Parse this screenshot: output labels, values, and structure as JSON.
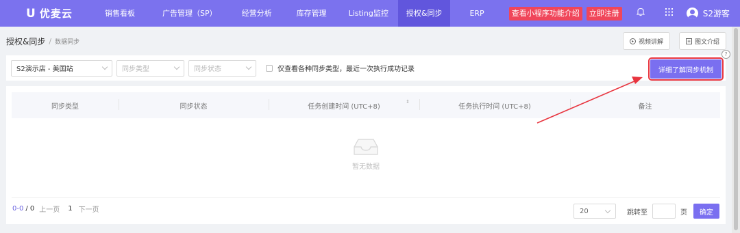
{
  "app": {
    "logo_mark": "U",
    "logo_text": "优麦云"
  },
  "nav": {
    "items": [
      "销售看板",
      "广告管理（SP）",
      "经营分析",
      "库存管理",
      "Listing监控",
      "授权&同步",
      "ERP"
    ],
    "active": "授权&同步"
  },
  "header": {
    "mini_program_button": "查看小程序功能介绍",
    "register_button": "立即注册",
    "bell_icon": "bell-icon",
    "apps_icon": "grid-icon",
    "user_name": "S2游客"
  },
  "breadcrumb": {
    "main": "授权&同步",
    "separator": "/",
    "sub": "数据同步"
  },
  "tools": {
    "video_button": "视频讲解",
    "doc_button": "图文介绍"
  },
  "filters": {
    "store": "S2演示店 - 美国站",
    "sync_type_placeholder": "同步类型",
    "sync_status_placeholder": "同步状态",
    "checkbox_label": "仅查看各种同步类型，最近一次执行成功记录",
    "detail_button": "详细了解同步机制"
  },
  "help_badge": "?",
  "table": {
    "columns": [
      "同步类型",
      "同步状态",
      "任务创建时间 (UTC+8)",
      "任务执行时间 (UTC+8)",
      "备注"
    ],
    "sort_icon": "⇕",
    "empty_text": "暂无数据"
  },
  "pagination": {
    "range": "0-0",
    "total": "/ 0",
    "prev": "上一页",
    "current": "1",
    "next": "下一页",
    "page_size": "20",
    "jump_label": "跳转至",
    "page_unit": "页",
    "confirm": "确定"
  },
  "colors": {
    "nav_bg": "#7b72ee",
    "nav_active": "#6156dd",
    "accent": "#7a6ff0",
    "red_button": "#f0465a",
    "annotation_red": "#e8353f"
  }
}
